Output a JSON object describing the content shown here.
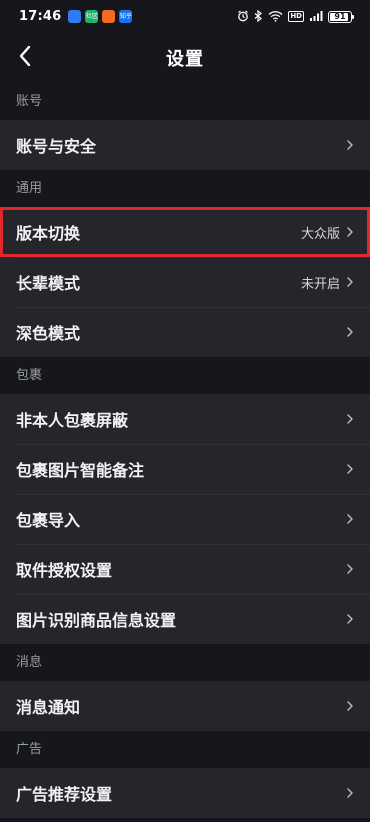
{
  "status_bar": {
    "time": "17:46",
    "apps": [
      {
        "icon": "app-icon-blue",
        "color": "#2f7bf6",
        "label": ""
      },
      {
        "icon": "app-icon-green",
        "color": "#1fb36b",
        "label": "社区"
      },
      {
        "icon": "app-icon-orange",
        "color": "#f26b21",
        "label": ""
      },
      {
        "icon": "app-icon-zhihu",
        "color": "#1772f6",
        "label": "知乎"
      }
    ],
    "indicators": [
      "alarm-icon",
      "bluetooth-icon",
      "wifi-icon",
      "hd-icon",
      "signal-icon"
    ],
    "hd_label": "HD",
    "battery_level": "91",
    "battery_fraction": 0.91
  },
  "nav": {
    "title": "设置",
    "back_icon": "chevron-left-icon"
  },
  "sections": [
    {
      "title": "账号",
      "items": [
        {
          "label": "账号与安全",
          "value": "",
          "highlighted": false
        }
      ]
    },
    {
      "title": "通用",
      "items": [
        {
          "label": "版本切换",
          "value": "大众版",
          "highlighted": true
        },
        {
          "label": "长辈模式",
          "value": "未开启",
          "highlighted": false
        },
        {
          "label": "深色模式",
          "value": "",
          "highlighted": false
        }
      ]
    },
    {
      "title": "包裹",
      "items": [
        {
          "label": "非本人包裹屏蔽",
          "value": "",
          "highlighted": false
        },
        {
          "label": "包裹图片智能备注",
          "value": "",
          "highlighted": false
        },
        {
          "label": "包裹导入",
          "value": "",
          "highlighted": false
        },
        {
          "label": "取件授权设置",
          "value": "",
          "highlighted": false
        },
        {
          "label": "图片识别商品信息设置",
          "value": "",
          "highlighted": false
        }
      ]
    },
    {
      "title": "消息",
      "items": [
        {
          "label": "消息通知",
          "value": "",
          "highlighted": false
        }
      ]
    },
    {
      "title": "广告",
      "items": [
        {
          "label": "广告推荐设置",
          "value": "",
          "highlighted": false
        }
      ]
    }
  ],
  "colors": {
    "background": "#16171c",
    "row_background": "#25262c",
    "section_title": "#9a9ca3",
    "highlight_border": "#e0282d"
  }
}
